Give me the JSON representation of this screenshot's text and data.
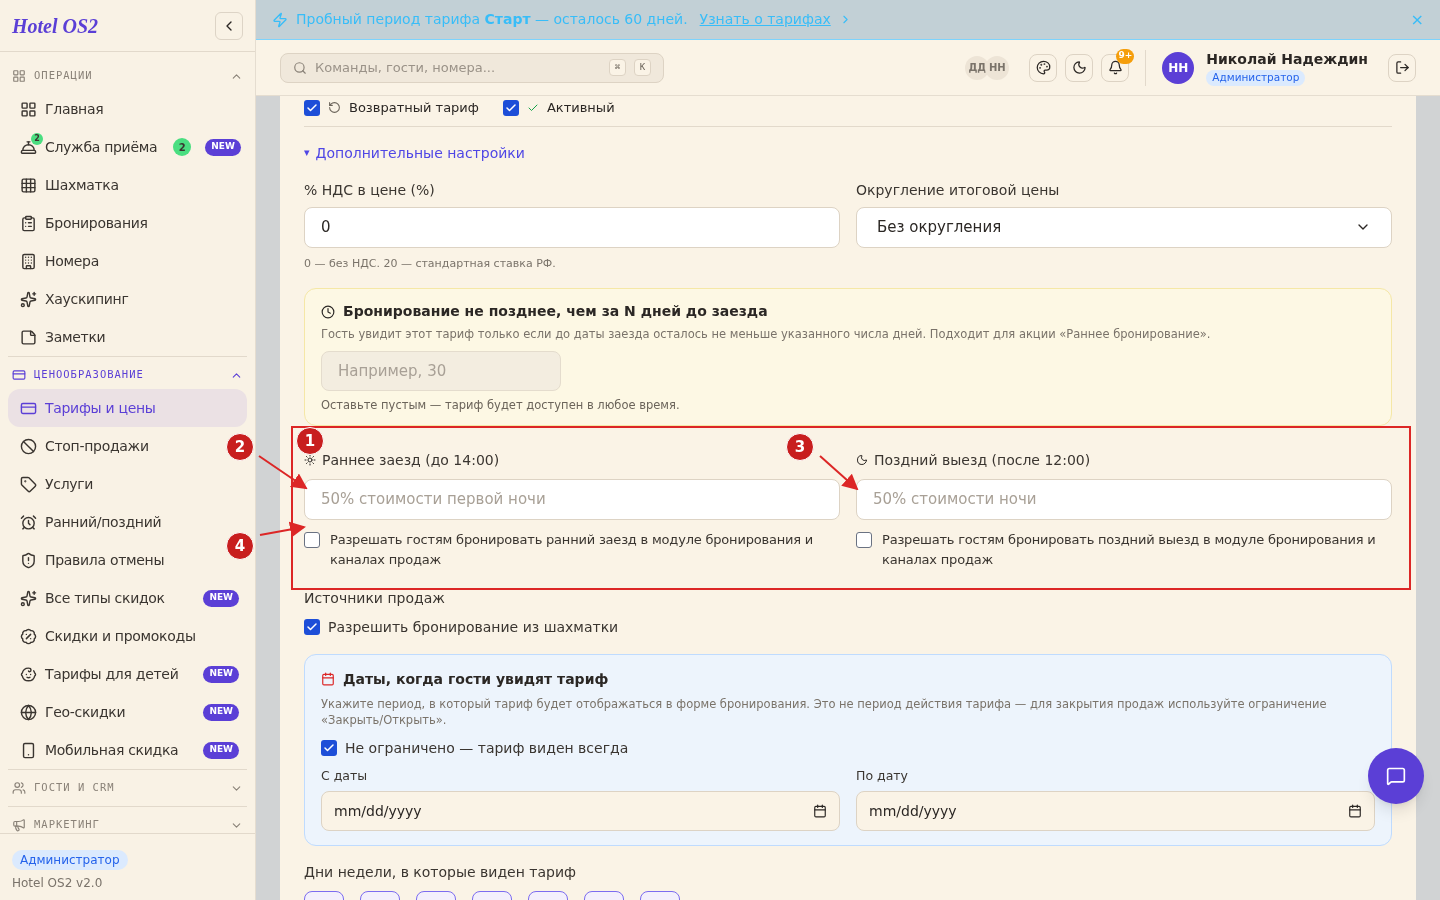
{
  "banner": {
    "text": "Пробный период тарифа **Старт** — осталось 60 дней.",
    "link": "Узнать о тарифах",
    "close": "×"
  },
  "sidebar": {
    "logo": "Hotel OS2",
    "sections": [
      {
        "title": "ОПЕРАЦИИ",
        "active": false,
        "expanded": true,
        "items": [
          {
            "label": "Главная",
            "selected": false
          },
          {
            "label": "Служба приёма",
            "icon_badge": "2",
            "count": "2",
            "tag": "NEW",
            "selected": false
          },
          {
            "label": "Шахматка",
            "selected": false
          },
          {
            "label": "Бронирования",
            "selected": false
          },
          {
            "label": "Номера",
            "selected": false
          },
          {
            "label": "Хаускипинг",
            "selected": false
          },
          {
            "label": "Заметки",
            "selected": false
          }
        ]
      },
      {
        "title": "ЦЕНООБРАЗОВАНИЕ",
        "active": true,
        "expanded": true,
        "items": [
          {
            "label": "Тарифы и цены",
            "selected": true
          },
          {
            "label": "Стоп-продажи",
            "selected": false
          },
          {
            "label": "Услуги",
            "selected": false
          },
          {
            "label": "Ранний/поздний",
            "selected": false
          },
          {
            "label": "Правила отмены",
            "selected": false
          },
          {
            "label": "Все типы скидок",
            "tag": "NEW",
            "selected": false
          },
          {
            "label": "Скидки и промокоды",
            "selected": false
          },
          {
            "label": "Тарифы для детей",
            "tag": "NEW",
            "selected": false
          },
          {
            "label": "Гео-скидки",
            "tag": "NEW",
            "selected": false
          },
          {
            "label": "Мобильная скидка",
            "tag": "NEW",
            "selected": false
          }
        ]
      },
      {
        "title": "ГОСТИ И CRM",
        "active": false,
        "expanded": false
      },
      {
        "title": "МАРКЕТИНГ",
        "active": false,
        "expanded": false
      }
    ],
    "role": "Администратор",
    "version": "Hotel OS2 v2.0"
  },
  "header": {
    "search_placeholder": "Команды, гости, номера...",
    "keys": [
      "⌘",
      "K"
    ],
    "presence": [
      "ДД",
      "НН"
    ],
    "notifications": "9+",
    "user_initials": "НН",
    "user_name": "Николай Надеждин",
    "user_role": "Администратор"
  },
  "form": {
    "top_checks": [
      {
        "label": "Возвратный тариф",
        "checked": true
      },
      {
        "label": "Активный",
        "checked": true
      }
    ],
    "advanced": {
      "caret": "▾",
      "label": "Дополнительные настройки",
      "expanded": true
    },
    "vat": {
      "label": "% НДС в цене (%)",
      "value": "0",
      "hint": "0 — без НДС. 20 — стандартная ставка РФ."
    },
    "rounding": {
      "label": "Округление итоговой цены",
      "value": "Без округления"
    },
    "min_days": {
      "title": "Бронирование не позднее, чем за N дней до заезда",
      "description": "Гость увидит этот тариф только если до даты заезда осталось не меньше указанного числа дней. Подходит для акции «Раннее бронирование».",
      "placeholder": "Например, 30",
      "hint": "Оставьте пустым — тариф будет доступен в любое время."
    },
    "early": {
      "label": "Раннее заезд (до 14:00)",
      "placeholder": "50% стоимости первой ночи",
      "check_label": "Разрешать гостям бронировать ранний заезд в модуле бронирования и каналах продаж",
      "checked": false
    },
    "late": {
      "label": "Поздний выезд (после 12:00)",
      "placeholder": "50% стоимости ночи",
      "check_label": "Разрешать гостям бронировать поздний выезд в модуле бронирования и каналах продаж",
      "checked": false
    },
    "sources": {
      "title": "Источники продаж",
      "check_label": "Разрешить бронирование из шахматки",
      "checked": true
    },
    "dates": {
      "title": "Даты, когда гости увидят тариф",
      "description": "Укажите период, в который тариф будет отображаться в форме бронирования. Это не период действия тарифа — для закрытия продаж используйте ограничение «Закрыть/Открыть».",
      "check_label": "Не ограничено — тариф виден всегда",
      "checked": true,
      "from_label": "С даты",
      "from_placeholder": "mm/dd/yyyy",
      "to_label": "По дату",
      "to_placeholder": "mm/dd/yyyy"
    },
    "weekdays_title": "Дни недели, в которые виден тариф"
  },
  "annotations": [
    "2",
    "1",
    "3",
    "4"
  ]
}
